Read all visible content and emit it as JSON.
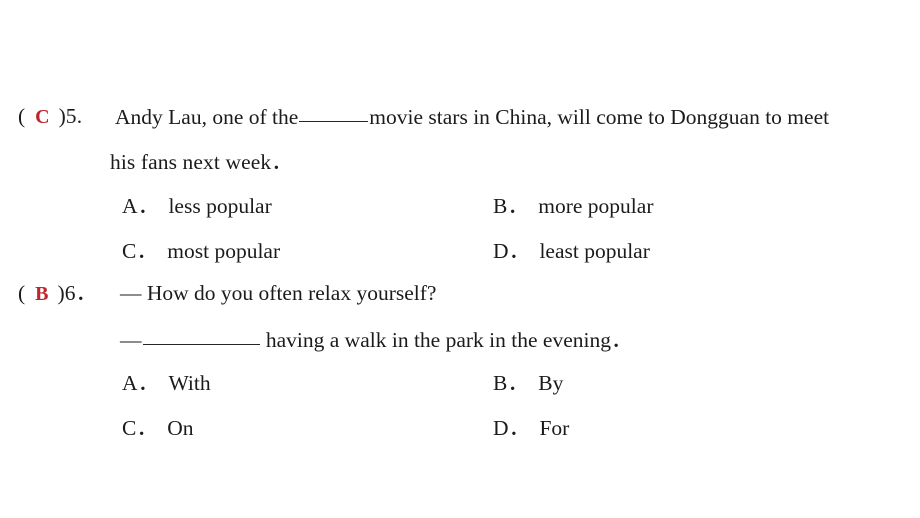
{
  "document": {
    "type": "exam-worksheet",
    "background_color": "#ffffff",
    "text_color": "#1b1b1b",
    "answer_color": "#bf252b"
  },
  "questions": [
    {
      "number": "5.",
      "answer": "C",
      "paren_open": "(",
      "paren_close": ")",
      "stem_line1_before_blank": "Andy Lau, one of the",
      "stem_line1_after_blank": "movie stars in China, will come to Dongguan to meet",
      "stem_line2": "his fans next week．",
      "options": [
        {
          "label": "A．",
          "text": "less popular"
        },
        {
          "label": "B．",
          "text": "more popular"
        },
        {
          "label": "C．",
          "text": "most popular"
        },
        {
          "label": "D．",
          "text": "least popular"
        }
      ]
    },
    {
      "number": "6．",
      "answer": "B",
      "paren_open": "(",
      "paren_close": ")",
      "dash": "—",
      "stem_line1": "How do you often relax yourself?",
      "answer_line_after_blank": "having a walk in the park in the evening．",
      "options": [
        {
          "label": "A．",
          "text": "With"
        },
        {
          "label": "B．",
          "text": "By"
        },
        {
          "label": "C．",
          "text": "On"
        },
        {
          "label": "D．",
          "text": "For"
        }
      ]
    }
  ]
}
